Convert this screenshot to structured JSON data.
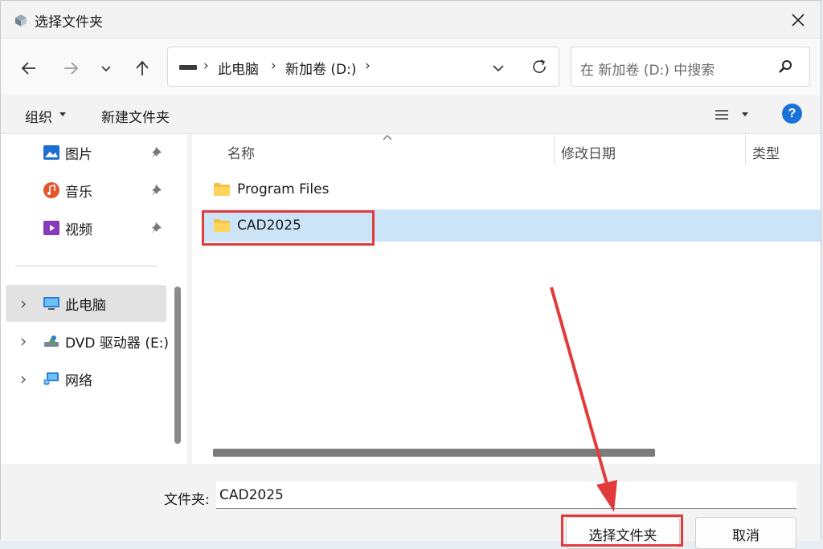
{
  "window": {
    "title": "选择文件夹",
    "close_label": "✕"
  },
  "address": {
    "crumbs": [
      "此电脑",
      "新加卷 (D:)"
    ],
    "separator": "›"
  },
  "search": {
    "placeholder": "在 新加卷 (D:) 中搜索"
  },
  "toolbar": {
    "organize_label": "组织",
    "new_folder_label": "新建文件夹",
    "help_label": "?"
  },
  "sidebar": {
    "items": [
      {
        "label": "图片",
        "icon": "pictures-icon",
        "pinned": true
      },
      {
        "label": "音乐",
        "icon": "music-icon",
        "pinned": true
      },
      {
        "label": "视频",
        "icon": "videos-icon",
        "pinned": true
      },
      {
        "label": "此电脑",
        "icon": "computer-icon",
        "selected": true
      },
      {
        "label": "DVD 驱动器 (E:)",
        "icon": "dvd-drive-icon"
      },
      {
        "label": "网络",
        "icon": "network-icon"
      }
    ]
  },
  "filelist": {
    "columns": [
      "名称",
      "修改日期",
      "类型"
    ],
    "rows": [
      {
        "name": "Program Files",
        "selected": false
      },
      {
        "name": "CAD2025",
        "selected": true
      }
    ]
  },
  "bottom": {
    "folder_label": "文件夹:",
    "folder_value": "CAD2025",
    "select_button": "选择文件夹",
    "cancel_button": "取消"
  },
  "colors": {
    "selection": "#cce4f7",
    "annotation": "#e23b3b",
    "accent": "#1a73d9"
  }
}
